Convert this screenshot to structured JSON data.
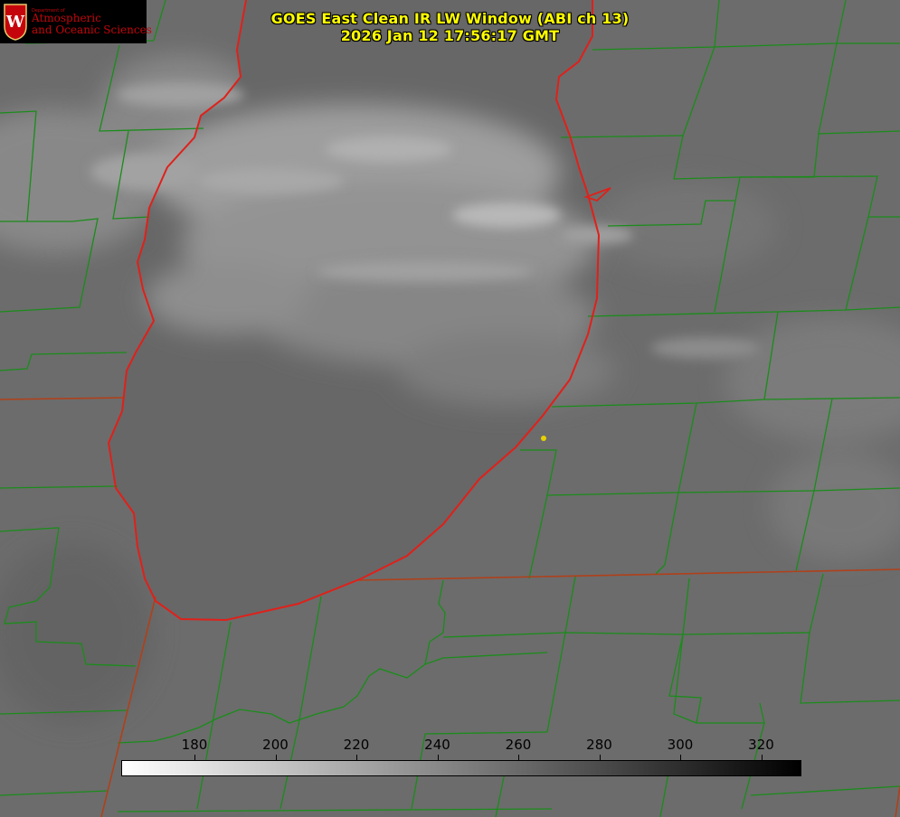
{
  "title": {
    "line1": "GOES East Clean IR LW Window (ABI ch 13)",
    "line2": "2026 Jan 12 17:56:17 GMT"
  },
  "logo": {
    "department": "Department of",
    "line1": "Atmospheric",
    "line2": "and Oceanic Sciences",
    "seal_letter": "W",
    "color": "#c5050c"
  },
  "colorbar": {
    "ticks": [
      "180",
      "200",
      "220",
      "240",
      "260",
      "280",
      "300",
      "320"
    ],
    "start_color": "#ffffff",
    "end_color": "#000000"
  },
  "colors": {
    "lake_outline": "#e0201a",
    "county_lines": "#1a8c1a",
    "state_lines": "#b0401a",
    "title_text": "#ffff00",
    "marker": "#e8d000"
  }
}
